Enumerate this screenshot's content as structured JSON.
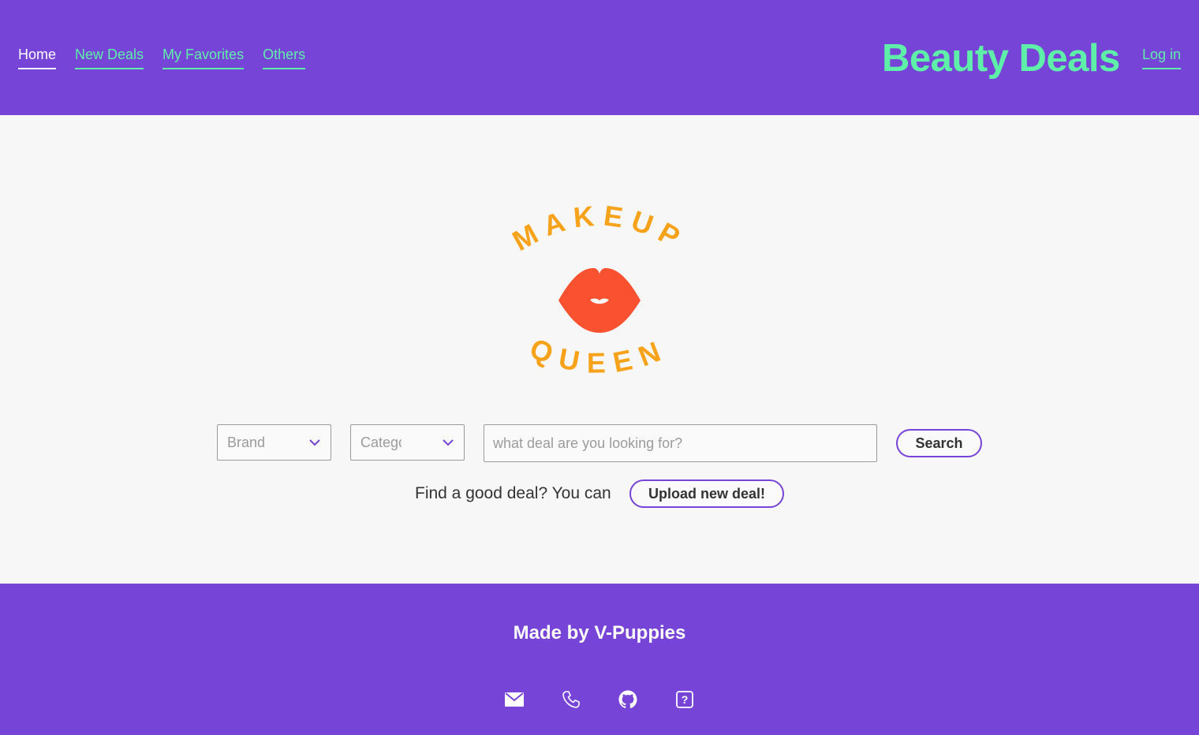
{
  "header": {
    "nav": [
      {
        "label": "Home",
        "active": true
      },
      {
        "label": "New Deals"
      },
      {
        "label": "My Favorites"
      },
      {
        "label": "Others"
      }
    ],
    "title": "Beauty Deals",
    "login_label": "Log in"
  },
  "logo": {
    "top_text": "MAKEUP",
    "bottom_text": "QUEEN",
    "icon": "lips-icon"
  },
  "search": {
    "brand_label": "Brand",
    "category_label": "Category",
    "placeholder": "what deal are you looking for?",
    "button_label": "Search"
  },
  "upload": {
    "text": "Find a good deal? You can",
    "button_label": "Upload new deal!"
  },
  "footer": {
    "title": "Made by V-Puppies",
    "icons": [
      "mail-icon",
      "phone-icon",
      "github-icon",
      "help-icon"
    ]
  },
  "colors": {
    "header_bg": "#7744d8",
    "accent": "#5ef0a8",
    "logo_text": "#f7a21b",
    "lips": "#fa5130",
    "page_bg": "#f7f7f7"
  }
}
